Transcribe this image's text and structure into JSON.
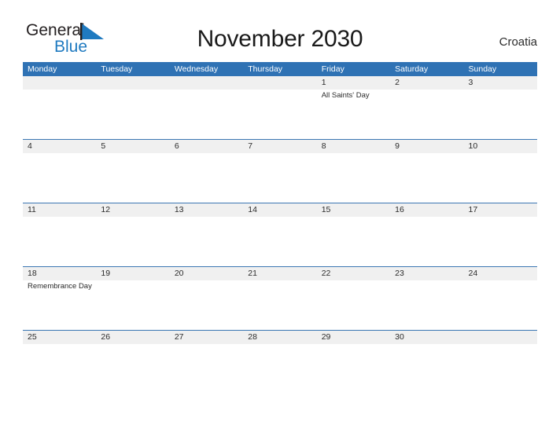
{
  "brand": {
    "name_part1": "General",
    "name_part2": "Blue",
    "flag_icon": "blue-triangle-flag-icon",
    "color_dark": "#231f20",
    "color_blue": "#1f7ac0"
  },
  "header": {
    "title": "November 2030",
    "country": "Croatia"
  },
  "calendar": {
    "header_bg": "#2f72b4",
    "date_band_bg": "#f0f0f0",
    "row_divider": "#3b77b3",
    "day_names": [
      "Monday",
      "Tuesday",
      "Wednesday",
      "Thursday",
      "Friday",
      "Saturday",
      "Sunday"
    ],
    "weeks": [
      {
        "days": [
          {
            "date": "",
            "event": ""
          },
          {
            "date": "",
            "event": ""
          },
          {
            "date": "",
            "event": ""
          },
          {
            "date": "",
            "event": ""
          },
          {
            "date": "1",
            "event": "All Saints' Day"
          },
          {
            "date": "2",
            "event": ""
          },
          {
            "date": "3",
            "event": ""
          }
        ]
      },
      {
        "days": [
          {
            "date": "4",
            "event": ""
          },
          {
            "date": "5",
            "event": ""
          },
          {
            "date": "6",
            "event": ""
          },
          {
            "date": "7",
            "event": ""
          },
          {
            "date": "8",
            "event": ""
          },
          {
            "date": "9",
            "event": ""
          },
          {
            "date": "10",
            "event": ""
          }
        ]
      },
      {
        "days": [
          {
            "date": "11",
            "event": ""
          },
          {
            "date": "12",
            "event": ""
          },
          {
            "date": "13",
            "event": ""
          },
          {
            "date": "14",
            "event": ""
          },
          {
            "date": "15",
            "event": ""
          },
          {
            "date": "16",
            "event": ""
          },
          {
            "date": "17",
            "event": ""
          }
        ]
      },
      {
        "days": [
          {
            "date": "18",
            "event": "Remembrance Day"
          },
          {
            "date": "19",
            "event": ""
          },
          {
            "date": "20",
            "event": ""
          },
          {
            "date": "21",
            "event": ""
          },
          {
            "date": "22",
            "event": ""
          },
          {
            "date": "23",
            "event": ""
          },
          {
            "date": "24",
            "event": ""
          }
        ]
      },
      {
        "days": [
          {
            "date": "25",
            "event": ""
          },
          {
            "date": "26",
            "event": ""
          },
          {
            "date": "27",
            "event": ""
          },
          {
            "date": "28",
            "event": ""
          },
          {
            "date": "29",
            "event": ""
          },
          {
            "date": "30",
            "event": ""
          },
          {
            "date": "",
            "event": ""
          }
        ]
      }
    ]
  }
}
